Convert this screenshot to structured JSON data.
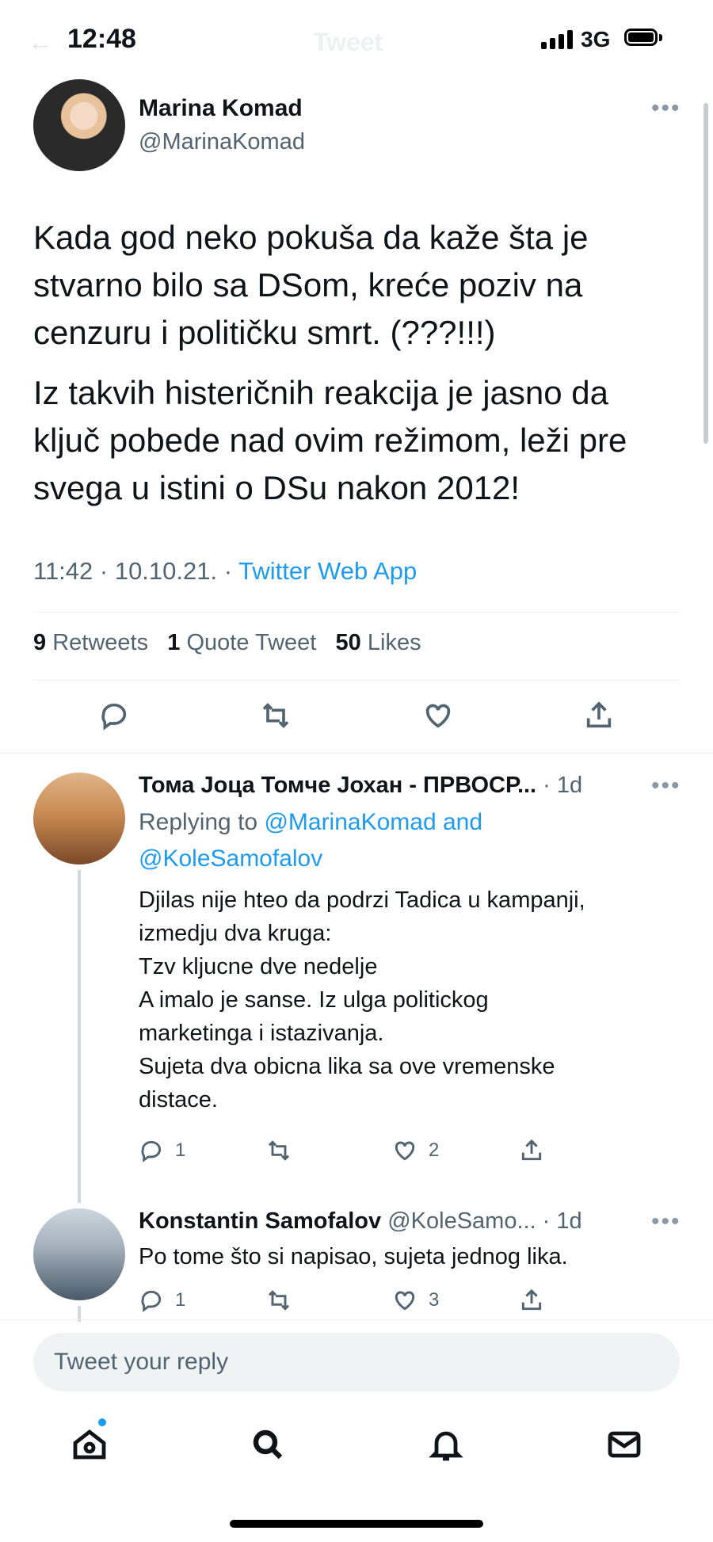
{
  "status_bar": {
    "time": "12:48",
    "network": "3G"
  },
  "header": {
    "title": "Tweet",
    "back_icon": "back-arrow-icon"
  },
  "tweet": {
    "author_name": "Marina Komad",
    "author_handle": "@MarinaKomad",
    "paragraphs": [
      "Kada god neko pokuša da kaže šta je stvarno bilo sa DSom, kreće poziv na cenzuru i političku smrt. (???!!!)",
      "Iz takvih histeričnih reakcija je jasno da ključ pobede nad ovim režimom, leži pre svega u istini o DSu nakon 2012!"
    ],
    "meta_time": "11:42 · 10.10.21. · ",
    "meta_source": "Twitter Web App",
    "retweets_count": "9",
    "retweets_label": " Retweets",
    "quotes_count": "1",
    "quotes_label": " Quote Tweet",
    "likes_count": "50",
    "likes_label": " Likes"
  },
  "replies": [
    {
      "name": "Тома Јоца Томче Јохан - ПРВОСР...",
      "time": " · 1d",
      "replying_prefix": "Replying to ",
      "replying_mention1": "@MarinaKomad",
      "replying_and": " and",
      "replying_mention2": "@KoleSamofalov",
      "lines": [
        "Djilas nije hteo da podrzi Tadica u kampanji,",
        "izmedju dva kruga:",
        "Tzv kljucne dve nedelje",
        "A imalo je sanse. Iz ulga politickog",
        "marketinga i istazivanja.",
        "Sujeta dva obicna lika sa ove vremenske",
        "distace."
      ],
      "reply_count": "1",
      "retweet_count": "",
      "like_count": "2"
    },
    {
      "name": "Konstantin Samofalov",
      "handle": " @KoleSamo...",
      "time": " · 1d",
      "text": "Po tome što si napisao, sujeta jednog lika.",
      "reply_count": "1",
      "retweet_count": "",
      "like_count": "3"
    }
  ],
  "reply_box": {
    "placeholder": "Tweet your reply"
  },
  "tabbar": [
    "home-icon",
    "search-icon",
    "notifications-icon",
    "messages-icon"
  ],
  "colors": {
    "accent": "#1d9bf0",
    "secondary_text": "#536471",
    "primary_text": "#0f1419"
  }
}
